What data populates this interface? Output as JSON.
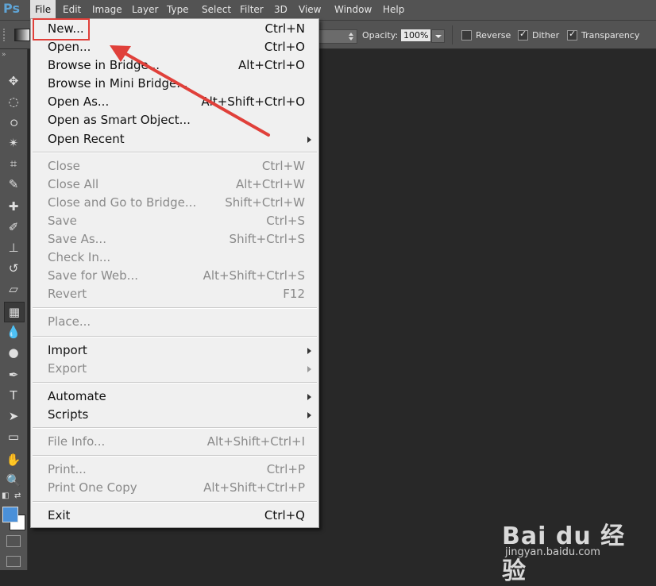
{
  "app": {
    "logo": "Ps"
  },
  "menubar": {
    "items": [
      "File",
      "Edit",
      "Image",
      "Layer",
      "Type",
      "Select",
      "Filter",
      "3D",
      "View",
      "Window",
      "Help"
    ]
  },
  "options_bar": {
    "opacity_label": "Opacity:",
    "opacity_value": "100%",
    "reverse_label": "Reverse",
    "reverse_checked": false,
    "dither_label": "Dither",
    "dither_checked": true,
    "transparency_label": "Transparency",
    "transparency_checked": true
  },
  "file_menu": {
    "items": [
      {
        "label": "New...",
        "shortcut": "Ctrl+N",
        "enabled": true
      },
      {
        "label": "Open...",
        "shortcut": "Ctrl+O",
        "enabled": true
      },
      {
        "label": "Browse in Bridge...",
        "shortcut": "Alt+Ctrl+O",
        "enabled": true
      },
      {
        "label": "Browse in Mini Bridge...",
        "shortcut": "",
        "enabled": true
      },
      {
        "label": "Open As...",
        "shortcut": "Alt+Shift+Ctrl+O",
        "enabled": true
      },
      {
        "label": "Open as Smart Object...",
        "shortcut": "",
        "enabled": true
      },
      {
        "label": "Open Recent",
        "shortcut": "",
        "enabled": true,
        "submenu": true
      },
      {
        "label": "Close",
        "shortcut": "Ctrl+W",
        "enabled": false
      },
      {
        "label": "Close All",
        "shortcut": "Alt+Ctrl+W",
        "enabled": false
      },
      {
        "label": "Close and Go to Bridge...",
        "shortcut": "Shift+Ctrl+W",
        "enabled": false
      },
      {
        "label": "Save",
        "shortcut": "Ctrl+S",
        "enabled": false
      },
      {
        "label": "Save As...",
        "shortcut": "Shift+Ctrl+S",
        "enabled": false
      },
      {
        "label": "Check In...",
        "shortcut": "",
        "enabled": false
      },
      {
        "label": "Save for Web...",
        "shortcut": "Alt+Shift+Ctrl+S",
        "enabled": false
      },
      {
        "label": "Revert",
        "shortcut": "F12",
        "enabled": false
      },
      {
        "label": "Place...",
        "shortcut": "",
        "enabled": false
      },
      {
        "label": "Import",
        "shortcut": "",
        "enabled": true,
        "submenu": true
      },
      {
        "label": "Export",
        "shortcut": "",
        "enabled": false,
        "submenu": true
      },
      {
        "label": "Automate",
        "shortcut": "",
        "enabled": true,
        "submenu": true
      },
      {
        "label": "Scripts",
        "shortcut": "",
        "enabled": true,
        "submenu": true
      },
      {
        "label": "File Info...",
        "shortcut": "Alt+Shift+Ctrl+I",
        "enabled": false
      },
      {
        "label": "Print...",
        "shortcut": "Ctrl+P",
        "enabled": false
      },
      {
        "label": "Print One Copy",
        "shortcut": "Alt+Shift+Ctrl+P",
        "enabled": false
      },
      {
        "label": "Exit",
        "shortcut": "Ctrl+Q",
        "enabled": true
      }
    ]
  },
  "toolbar": {
    "tools": [
      "move-tool",
      "marquee-tool",
      "lasso-tool",
      "magic-wand-tool",
      "crop-tool",
      "eyedropper-tool",
      "healing-brush-tool",
      "brush-tool",
      "clone-stamp-tool",
      "history-brush-tool",
      "eraser-tool",
      "gradient-tool",
      "blur-tool",
      "dodge-tool",
      "pen-tool",
      "type-tool",
      "path-selection-tool",
      "shape-tool",
      "hand-tool",
      "zoom-tool"
    ],
    "foreground_color": "#4a90d9",
    "background_color": "#ffffff"
  },
  "colors": {
    "accent": "#e0403a",
    "menu_bg": "#f0f0f0",
    "chrome": "#535353",
    "canvas": "#282828"
  },
  "watermark": {
    "brand": "Bai du 经验",
    "url": "jingyan.baidu.com"
  }
}
